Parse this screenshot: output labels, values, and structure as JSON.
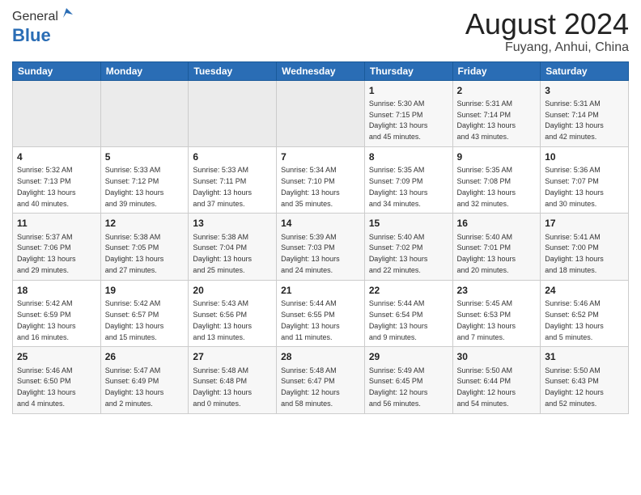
{
  "header": {
    "logo_general": "General",
    "logo_blue": "Blue",
    "main_title": "August 2024",
    "sub_title": "Fuyang, Anhui, China"
  },
  "calendar": {
    "days_of_week": [
      "Sunday",
      "Monday",
      "Tuesday",
      "Wednesday",
      "Thursday",
      "Friday",
      "Saturday"
    ],
    "weeks": [
      [
        {
          "day": "",
          "info": ""
        },
        {
          "day": "",
          "info": ""
        },
        {
          "day": "",
          "info": ""
        },
        {
          "day": "",
          "info": ""
        },
        {
          "day": "1",
          "info": "Sunrise: 5:30 AM\nSunset: 7:15 PM\nDaylight: 13 hours\nand 45 minutes."
        },
        {
          "day": "2",
          "info": "Sunrise: 5:31 AM\nSunset: 7:14 PM\nDaylight: 13 hours\nand 43 minutes."
        },
        {
          "day": "3",
          "info": "Sunrise: 5:31 AM\nSunset: 7:14 PM\nDaylight: 13 hours\nand 42 minutes."
        }
      ],
      [
        {
          "day": "4",
          "info": "Sunrise: 5:32 AM\nSunset: 7:13 PM\nDaylight: 13 hours\nand 40 minutes."
        },
        {
          "day": "5",
          "info": "Sunrise: 5:33 AM\nSunset: 7:12 PM\nDaylight: 13 hours\nand 39 minutes."
        },
        {
          "day": "6",
          "info": "Sunrise: 5:33 AM\nSunset: 7:11 PM\nDaylight: 13 hours\nand 37 minutes."
        },
        {
          "day": "7",
          "info": "Sunrise: 5:34 AM\nSunset: 7:10 PM\nDaylight: 13 hours\nand 35 minutes."
        },
        {
          "day": "8",
          "info": "Sunrise: 5:35 AM\nSunset: 7:09 PM\nDaylight: 13 hours\nand 34 minutes."
        },
        {
          "day": "9",
          "info": "Sunrise: 5:35 AM\nSunset: 7:08 PM\nDaylight: 13 hours\nand 32 minutes."
        },
        {
          "day": "10",
          "info": "Sunrise: 5:36 AM\nSunset: 7:07 PM\nDaylight: 13 hours\nand 30 minutes."
        }
      ],
      [
        {
          "day": "11",
          "info": "Sunrise: 5:37 AM\nSunset: 7:06 PM\nDaylight: 13 hours\nand 29 minutes."
        },
        {
          "day": "12",
          "info": "Sunrise: 5:38 AM\nSunset: 7:05 PM\nDaylight: 13 hours\nand 27 minutes."
        },
        {
          "day": "13",
          "info": "Sunrise: 5:38 AM\nSunset: 7:04 PM\nDaylight: 13 hours\nand 25 minutes."
        },
        {
          "day": "14",
          "info": "Sunrise: 5:39 AM\nSunset: 7:03 PM\nDaylight: 13 hours\nand 24 minutes."
        },
        {
          "day": "15",
          "info": "Sunrise: 5:40 AM\nSunset: 7:02 PM\nDaylight: 13 hours\nand 22 minutes."
        },
        {
          "day": "16",
          "info": "Sunrise: 5:40 AM\nSunset: 7:01 PM\nDaylight: 13 hours\nand 20 minutes."
        },
        {
          "day": "17",
          "info": "Sunrise: 5:41 AM\nSunset: 7:00 PM\nDaylight: 13 hours\nand 18 minutes."
        }
      ],
      [
        {
          "day": "18",
          "info": "Sunrise: 5:42 AM\nSunset: 6:59 PM\nDaylight: 13 hours\nand 16 minutes."
        },
        {
          "day": "19",
          "info": "Sunrise: 5:42 AM\nSunset: 6:57 PM\nDaylight: 13 hours\nand 15 minutes."
        },
        {
          "day": "20",
          "info": "Sunrise: 5:43 AM\nSunset: 6:56 PM\nDaylight: 13 hours\nand 13 minutes."
        },
        {
          "day": "21",
          "info": "Sunrise: 5:44 AM\nSunset: 6:55 PM\nDaylight: 13 hours\nand 11 minutes."
        },
        {
          "day": "22",
          "info": "Sunrise: 5:44 AM\nSunset: 6:54 PM\nDaylight: 13 hours\nand 9 minutes."
        },
        {
          "day": "23",
          "info": "Sunrise: 5:45 AM\nSunset: 6:53 PM\nDaylight: 13 hours\nand 7 minutes."
        },
        {
          "day": "24",
          "info": "Sunrise: 5:46 AM\nSunset: 6:52 PM\nDaylight: 13 hours\nand 5 minutes."
        }
      ],
      [
        {
          "day": "25",
          "info": "Sunrise: 5:46 AM\nSunset: 6:50 PM\nDaylight: 13 hours\nand 4 minutes."
        },
        {
          "day": "26",
          "info": "Sunrise: 5:47 AM\nSunset: 6:49 PM\nDaylight: 13 hours\nand 2 minutes."
        },
        {
          "day": "27",
          "info": "Sunrise: 5:48 AM\nSunset: 6:48 PM\nDaylight: 13 hours\nand 0 minutes."
        },
        {
          "day": "28",
          "info": "Sunrise: 5:48 AM\nSunset: 6:47 PM\nDaylight: 12 hours\nand 58 minutes."
        },
        {
          "day": "29",
          "info": "Sunrise: 5:49 AM\nSunset: 6:45 PM\nDaylight: 12 hours\nand 56 minutes."
        },
        {
          "day": "30",
          "info": "Sunrise: 5:50 AM\nSunset: 6:44 PM\nDaylight: 12 hours\nand 54 minutes."
        },
        {
          "day": "31",
          "info": "Sunrise: 5:50 AM\nSunset: 6:43 PM\nDaylight: 12 hours\nand 52 minutes."
        }
      ]
    ]
  }
}
